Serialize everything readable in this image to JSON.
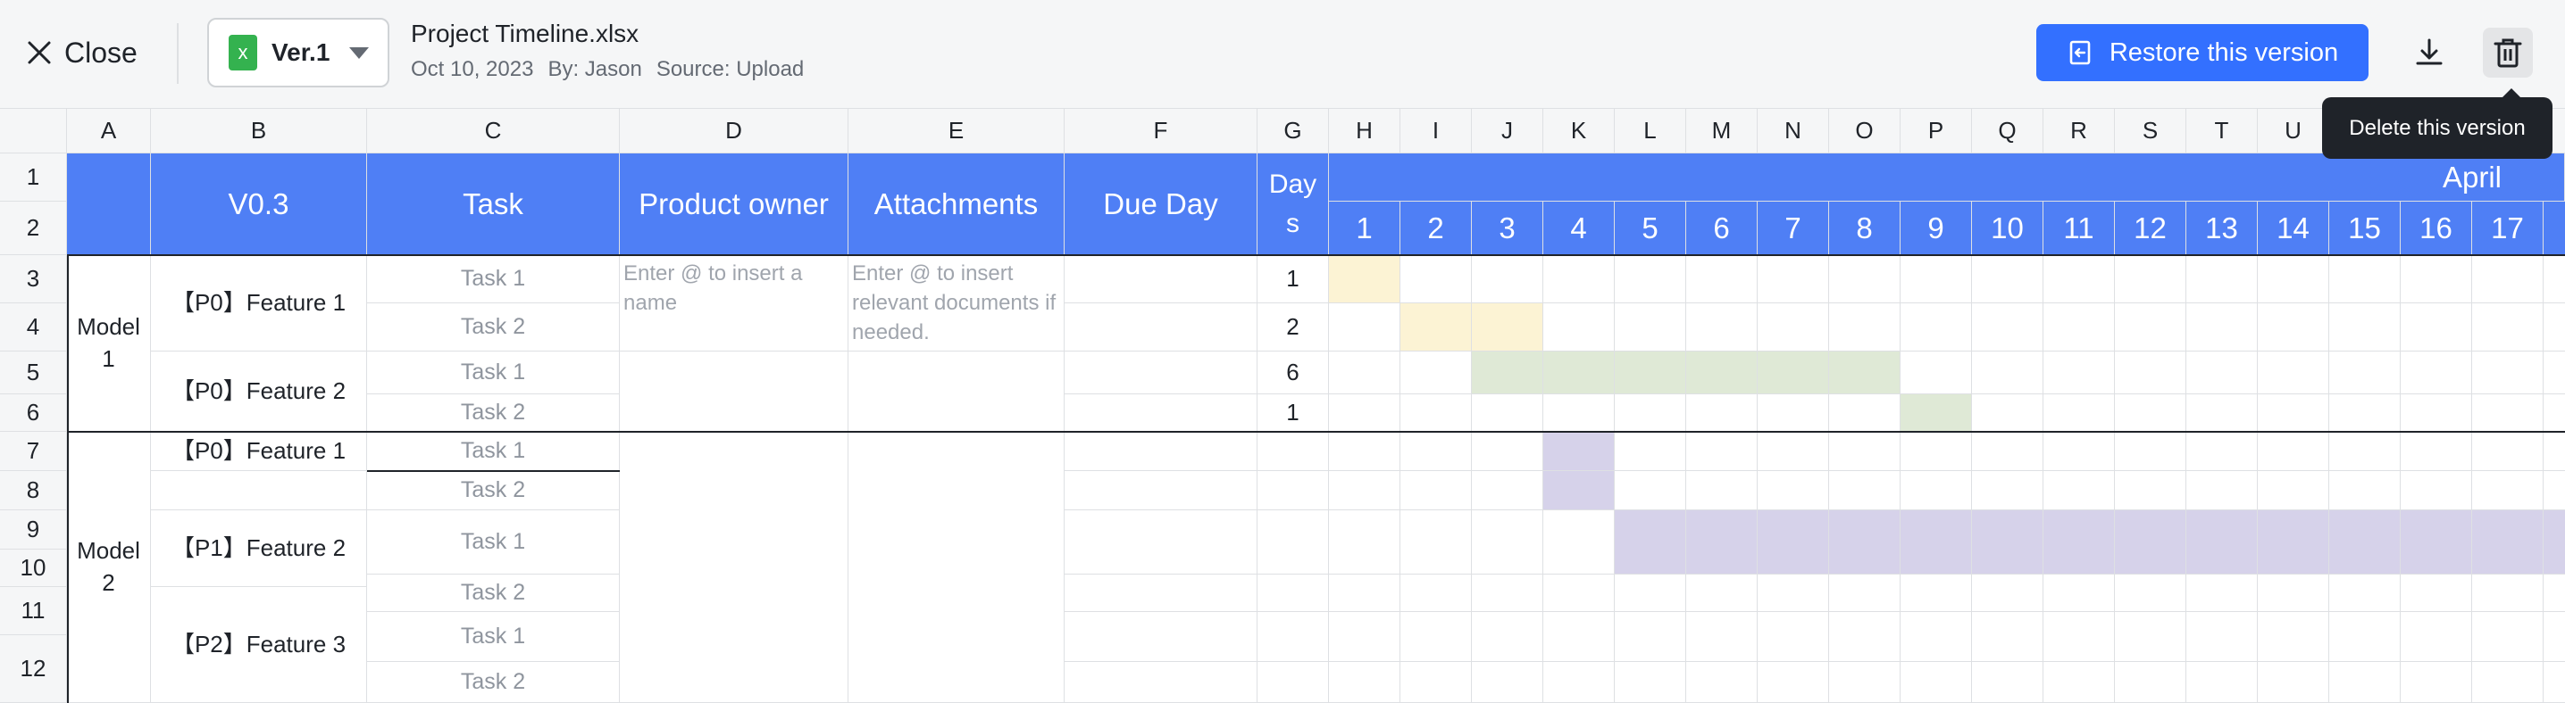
{
  "toolbar": {
    "close_label": "Close",
    "version_label": "Ver.1",
    "file_name": "Project Timeline.xlsx",
    "date": "Oct 10, 2023",
    "by": "By: Jason",
    "source": "Source: Upload",
    "restore_label": "Restore this version",
    "delete_tooltip": "Delete this version"
  },
  "colors": {
    "accent": "#3370ff",
    "header_blue": "#4f7ff5",
    "bar_yellow": "#fcf3d4",
    "bar_green": "#dfe9d6",
    "bar_purple": "#d6d2ea",
    "tooltip_bg": "#1f2329"
  },
  "icons": [
    "close-icon",
    "excel-file-icon",
    "chevron-down-icon",
    "restore-icon",
    "download-icon",
    "trash-icon"
  ],
  "sheet": {
    "columns": [
      "A",
      "B",
      "C",
      "D",
      "E",
      "F",
      "G",
      "H",
      "I",
      "J",
      "K",
      "L",
      "M",
      "N",
      "O",
      "P",
      "Q",
      "R",
      "S",
      "T",
      "U"
    ],
    "rows": [
      "1",
      "2",
      "3",
      "4",
      "5",
      "6",
      "7",
      "8",
      "9",
      "10",
      "11",
      "12"
    ],
    "header": {
      "version": "V0.3",
      "task": "Task",
      "product_owner": "Product owner",
      "attachments": "Attachments",
      "due_day": "Due Day",
      "days": "Day\ns",
      "month": "April",
      "days_of_month": [
        "1",
        "2",
        "3",
        "4",
        "5",
        "6",
        "7",
        "8",
        "9",
        "10",
        "11",
        "12",
        "13",
        "14",
        "15",
        "16",
        "17"
      ]
    },
    "models": [
      "Model\n1",
      "Model\n2"
    ],
    "features": [
      "【P0】Feature 1",
      "【P0】Feature 2",
      "【P0】Feature 1",
      "【P1】Feature 2",
      "【P2】Feature 3"
    ],
    "tasks": [
      "Task 1",
      "Task 2",
      "Task 1",
      "Task 2",
      "Task 1",
      "Task 2",
      "Task 1",
      "Task 2",
      "Task 1",
      "Task 2"
    ],
    "owner_hint": "Enter @ to insert a name",
    "attachment_hint": "Enter @ to insert relevant documents if needed.",
    "day_counts": [
      "1",
      "2",
      "6",
      "1"
    ]
  }
}
